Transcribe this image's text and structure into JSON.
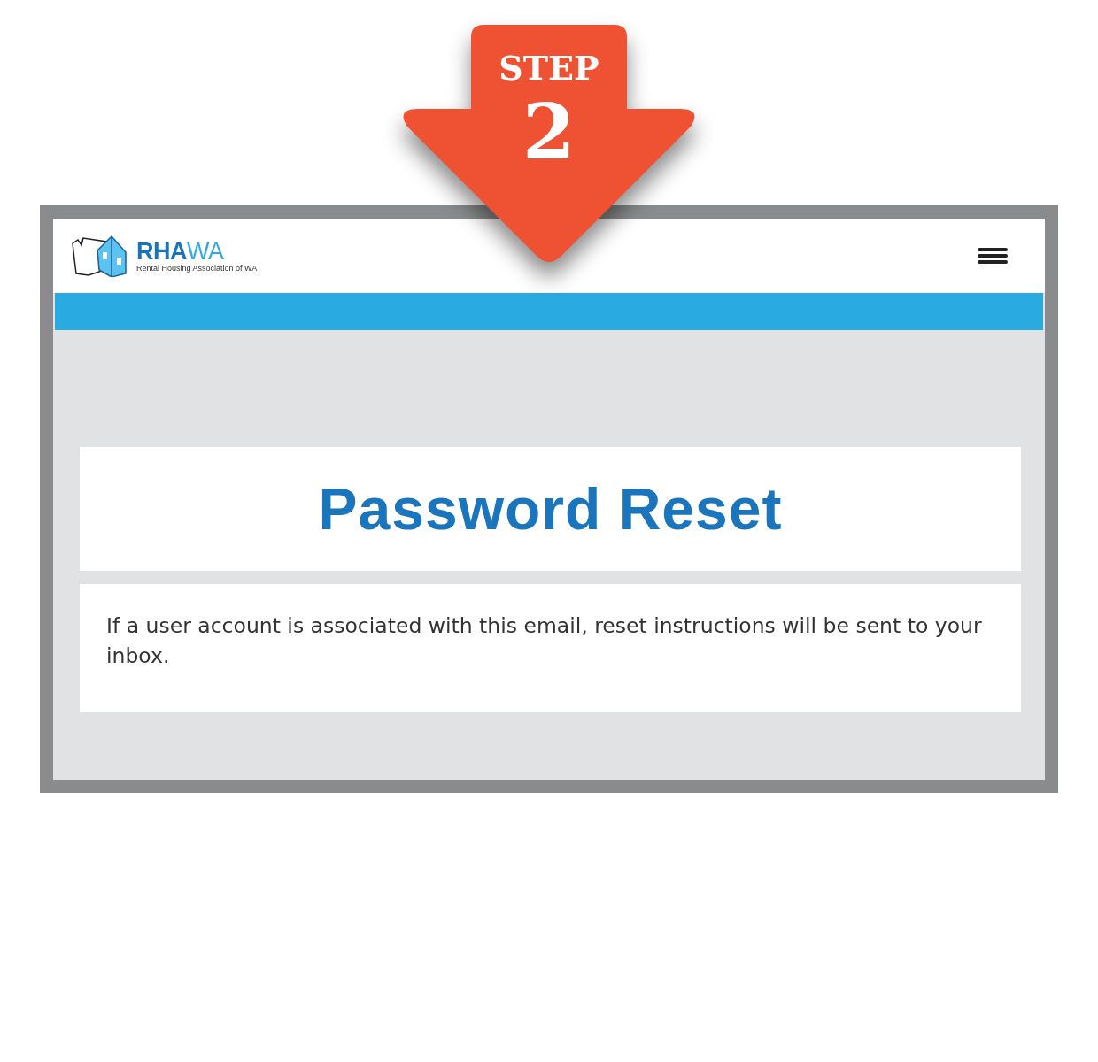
{
  "step_badge": {
    "label": "STEP",
    "number": "2"
  },
  "header": {
    "wordmark": [
      "RHA",
      "WA"
    ],
    "tagline": "Rental Housing Association of WA"
  },
  "title": "Password Reset",
  "message": "If a user account is associated with this email, reset instructions will be sent to your inbox."
}
